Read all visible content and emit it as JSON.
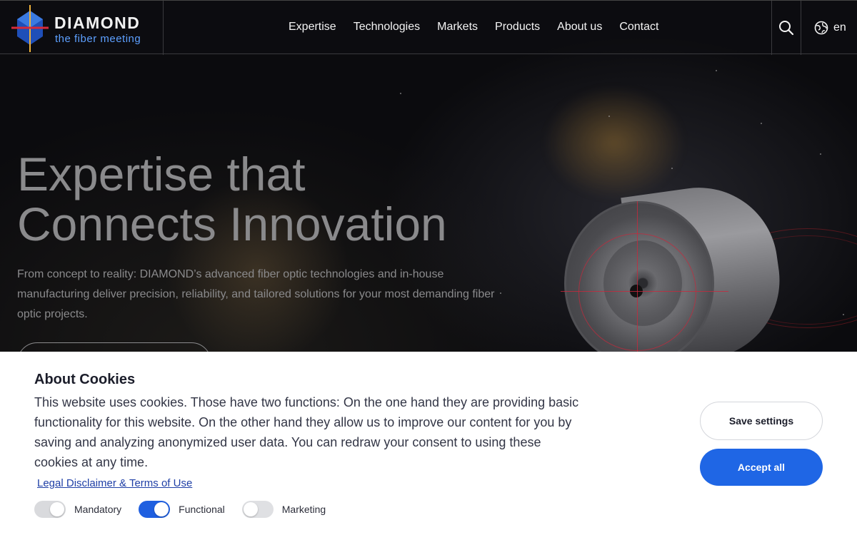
{
  "brand": {
    "name": "DIAMOND",
    "tagline": "the fiber meeting"
  },
  "nav": {
    "items": [
      {
        "label": "Expertise"
      },
      {
        "label": "Technologies"
      },
      {
        "label": "Markets"
      },
      {
        "label": "Products"
      },
      {
        "label": "About us"
      },
      {
        "label": "Contact"
      }
    ],
    "language": "en"
  },
  "hero": {
    "title_line1": "Expertise that",
    "title_line2": "Connects Innovation",
    "text": "From concept to reality: DIAMOND’s advanced fiber optic technologies and in-house manufacturing deliver precision, reliability, and tailored solutions for your most demanding fiber optic projects."
  },
  "cookie": {
    "title": "About Cookies",
    "text": "This website uses cookies. Those have two functions: On the one hand they are providing basic functionality for this website. On the other hand they allow us to improve our content for you by saving and analyzing anonymized user data. You can redraw your consent to using these cookies at any time.",
    "link": "Legal Disclaimer & Terms of Use",
    "toggles": [
      {
        "label": "Mandatory",
        "state": "on",
        "disabled": true
      },
      {
        "label": "Functional",
        "state": "on",
        "disabled": false
      },
      {
        "label": "Marketing",
        "state": "off",
        "disabled": false
      }
    ],
    "save_label": "Save settings",
    "accept_label": "Accept all"
  },
  "colors": {
    "accent": "#1f66e5",
    "logo_blue": "#5da0ff",
    "link": "#1f3fa6"
  },
  "icons": {
    "search": "search-icon",
    "globe": "globe-icon"
  }
}
